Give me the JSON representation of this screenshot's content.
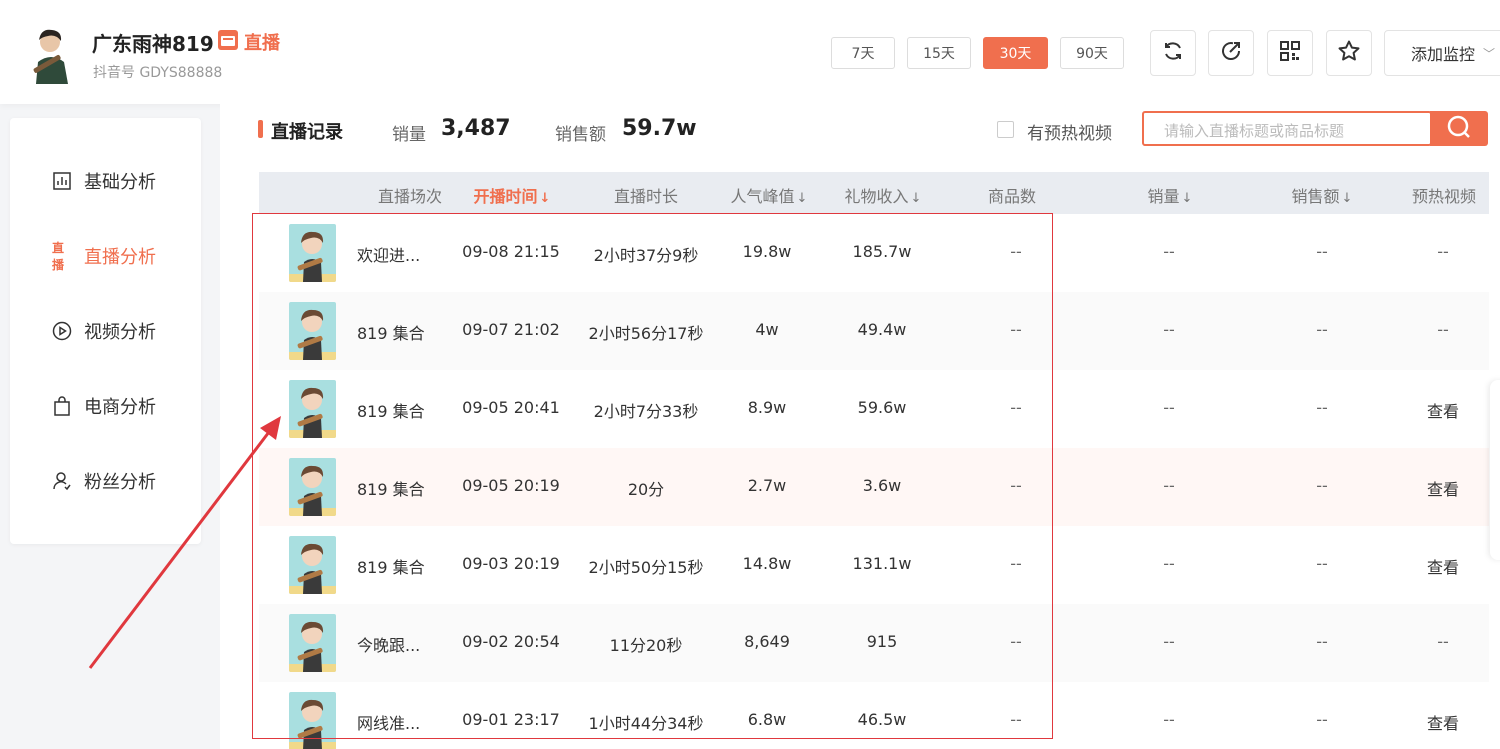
{
  "profile": {
    "name": "广东雨神819",
    "live_tag": "直播",
    "douyin_id": "抖音号 GDYS88888"
  },
  "period_buttons": [
    {
      "label": "7天",
      "active": false
    },
    {
      "label": "15天",
      "active": false
    },
    {
      "label": "30天",
      "active": true
    },
    {
      "label": "90天",
      "active": false
    }
  ],
  "toolbar": {
    "icons": [
      "refresh-icon",
      "share-icon",
      "qrcode-icon",
      "star-icon"
    ],
    "add_monitor_label": "添加监控"
  },
  "sidebar": {
    "items": [
      {
        "label": "基础分析",
        "icon": "bar-chart-icon",
        "active": false
      },
      {
        "label": "直播分析",
        "icon": "live-icon",
        "active": true
      },
      {
        "label": "视频分析",
        "icon": "play-circle-icon",
        "active": false
      },
      {
        "label": "电商分析",
        "icon": "shopping-bag-icon",
        "active": false
      },
      {
        "label": "粉丝分析",
        "icon": "user-icon",
        "active": false
      }
    ]
  },
  "section": {
    "title": "直播记录",
    "sales_label": "销量",
    "sales_value": "3,487",
    "revenue_label": "销售额",
    "revenue_value": "59.7w",
    "preheat_label": "有预热视频",
    "search_placeholder": "请输入直播标题或商品标题"
  },
  "table": {
    "columns": [
      {
        "label": "直播场次",
        "sortable": false,
        "sorted": false
      },
      {
        "label": "开播时间",
        "sortable": true,
        "sorted": true
      },
      {
        "label": "直播时长",
        "sortable": false,
        "sorted": false
      },
      {
        "label": "人气峰值",
        "sortable": true,
        "sorted": false
      },
      {
        "label": "礼物收入",
        "sortable": true,
        "sorted": false
      },
      {
        "label": "商品数",
        "sortable": false,
        "sorted": false
      },
      {
        "label": "销量",
        "sortable": true,
        "sorted": false
      },
      {
        "label": "销售额",
        "sortable": true,
        "sorted": false
      },
      {
        "label": "预热视频",
        "sortable": false,
        "sorted": false
      }
    ],
    "sort_arrow": "↓",
    "rows": [
      {
        "title": "欢迎进...",
        "start": "09-08 21:15",
        "duration": "2小时37分9秒",
        "peak": "19.8w",
        "gift": "185.7w",
        "products": "--",
        "sales": "--",
        "revenue": "--",
        "preheat": "--"
      },
      {
        "title": "819 集合",
        "start": "09-07 21:02",
        "duration": "2小时56分17秒",
        "peak": "4w",
        "gift": "49.4w",
        "products": "--",
        "sales": "--",
        "revenue": "--",
        "preheat": "--"
      },
      {
        "title": "819 集合",
        "start": "09-05 20:41",
        "duration": "2小时7分33秒",
        "peak": "8.9w",
        "gift": "59.6w",
        "products": "--",
        "sales": "--",
        "revenue": "--",
        "preheat": "查看"
      },
      {
        "title": "819 集合",
        "start": "09-05 20:19",
        "duration": "20分",
        "peak": "2.7w",
        "gift": "3.6w",
        "products": "--",
        "sales": "--",
        "revenue": "--",
        "preheat": "查看"
      },
      {
        "title": "819 集合",
        "start": "09-03 20:19",
        "duration": "2小时50分15秒",
        "peak": "14.8w",
        "gift": "131.1w",
        "products": "--",
        "sales": "--",
        "revenue": "--",
        "preheat": "查看"
      },
      {
        "title": "今晚跟...",
        "start": "09-02 20:54",
        "duration": "11分20秒",
        "peak": "8,649",
        "gift": "915",
        "products": "--",
        "sales": "--",
        "revenue": "--",
        "preheat": "--"
      },
      {
        "title": "网线准...",
        "start": "09-01 23:17",
        "duration": "1小时44分34秒",
        "peak": "6.8w",
        "gift": "46.5w",
        "products": "--",
        "sales": "--",
        "revenue": "--",
        "preheat": "查看"
      }
    ]
  },
  "colors": {
    "accent": "#f06f4e",
    "annotation_red": "#e0383e",
    "header_bg": "#e9ecf1"
  }
}
